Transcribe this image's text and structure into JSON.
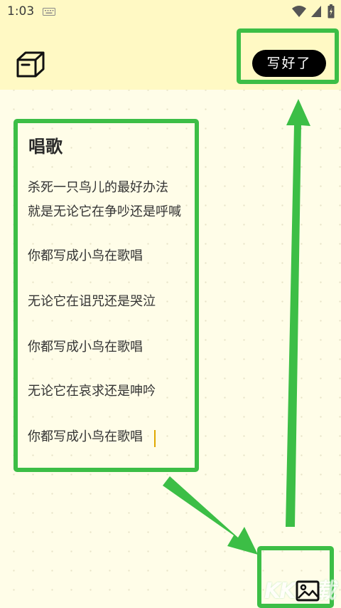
{
  "status_bar": {
    "time": "1:03",
    "icons": [
      "keyboard-icon",
      "wifi-icon",
      "signal-icon",
      "battery-icon"
    ]
  },
  "toolbar": {
    "box_icon": "box-icon",
    "done_label": "写好了"
  },
  "note": {
    "title": "唱歌",
    "lines": [
      "杀死一只鸟儿的最好办法",
      "就是无论它在争吵还是呼喊",
      "你都写成小鸟在歌唱",
      "无论它在诅咒还是哭泣",
      "你都写成小鸟在歌唱",
      "无论它在哀求还是呻吟",
      "你都写成小鸟在歌唱"
    ]
  },
  "bottom_toolbar": {
    "image_icon": "image-icon"
  },
  "watermark": "KK下载",
  "colors": {
    "background": "#fffde8",
    "header": "#fff9c4",
    "highlight": "#3cbe46",
    "button": "#000000",
    "cursor": "#e0a800"
  }
}
